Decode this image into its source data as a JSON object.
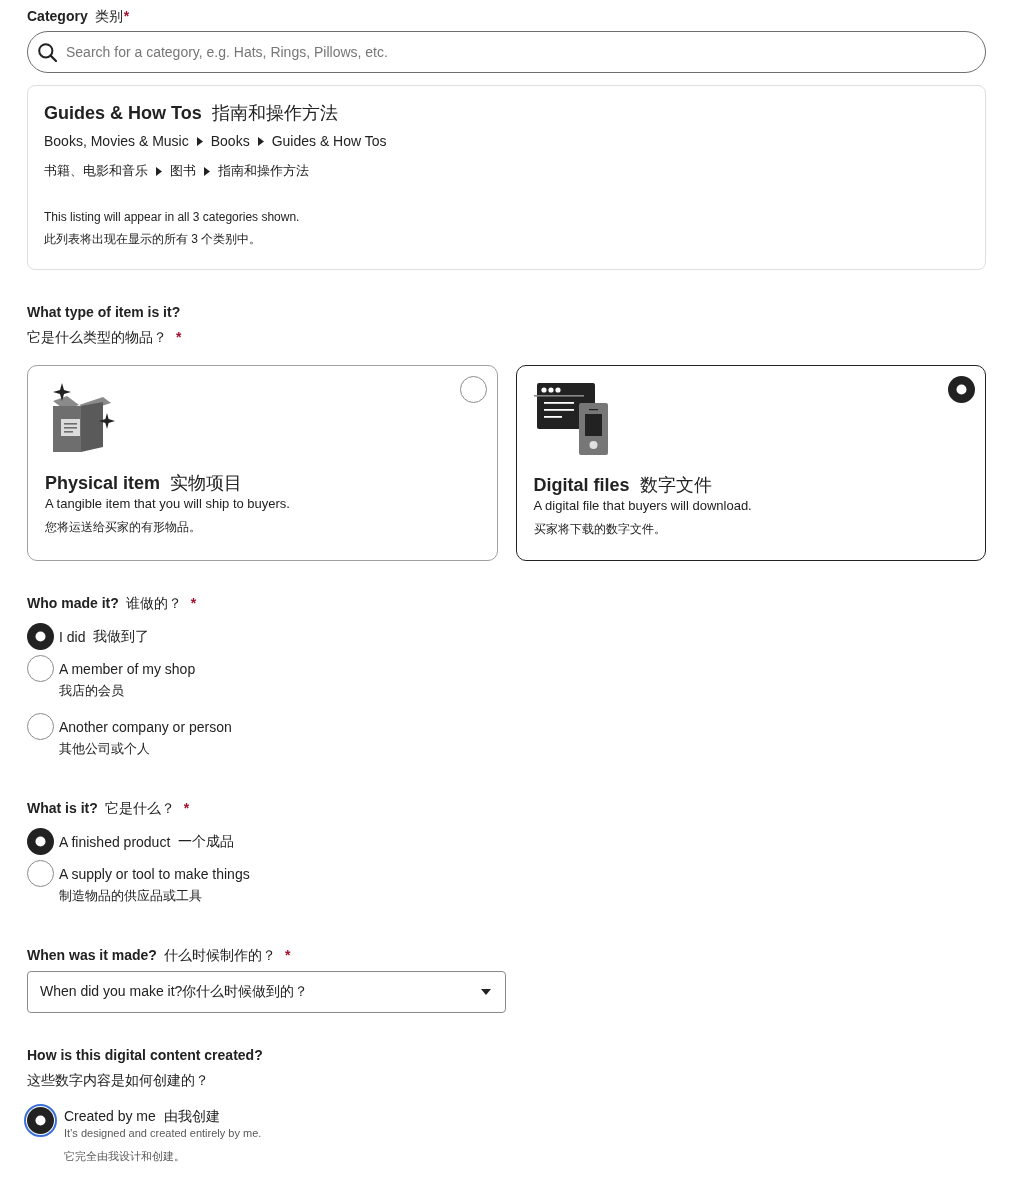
{
  "category": {
    "label": "Category",
    "label_zh": "类别",
    "required_mark": "*",
    "search": {
      "placeholder": "Search for a category, e.g. Hats, Rings, Pillows, etc."
    },
    "selected": {
      "title": "Guides & How Tos",
      "title_zh": "指南和操作方法",
      "path": [
        "Books, Movies & Music",
        "Books",
        "Guides & How Tos"
      ],
      "path_zh": [
        "书籍、电影和音乐",
        "图书",
        "指南和操作方法"
      ],
      "note": "This listing will appear in all 3 categories shown.",
      "note_zh": "此列表将出现在显示的所有 3 个类别中。"
    }
  },
  "item_type": {
    "label": "What type of item is it?",
    "label_below": "它是什么类型的物品？",
    "required_mark": "*",
    "options": [
      {
        "kind": "physical",
        "title": "Physical item",
        "title_zh": "实物项目",
        "description": "A tangible item that you will ship to buyers.",
        "description_zh": "您将运送给买家的有形物品。",
        "selected": false
      },
      {
        "kind": "digital",
        "title": "Digital files",
        "title_zh": "数字文件",
        "description": "A digital file that buyers will download.",
        "description_zh": "买家将下载的数字文件。",
        "selected": true
      }
    ]
  },
  "who_made": {
    "label": "Who made it?",
    "label_zh": "谁做的？",
    "required_mark": "*",
    "options": [
      {
        "label": "I did",
        "label_zh": "我做到了",
        "selected": true
      },
      {
        "label": "A member of my shop",
        "sub_zh": "我店的会员",
        "selected": false
      },
      {
        "label": "Another company or person",
        "sub_zh": "其他公司或个人",
        "selected": false
      }
    ]
  },
  "what_is_it": {
    "label": "What is it?",
    "label_zh": "它是什么？",
    "required_mark": "*",
    "options": [
      {
        "label": "A finished product",
        "label_zh": "一个成品",
        "selected": true
      },
      {
        "label": "A supply or tool to make things",
        "sub_zh": "制造物品的供应品或工具",
        "selected": false
      }
    ]
  },
  "when_made": {
    "label": "When was it made?",
    "label_zh": "什么时候制作的？",
    "required_mark": "*",
    "select": {
      "value": "When did you make it?你什么时候做到的？"
    }
  },
  "creation": {
    "label": "How is this digital content created?",
    "label_below": "这些数字内容是如何创建的？",
    "options": [
      {
        "label": "Created by me",
        "label_zh": "由我创建",
        "description": "It’s designed and created entirely by me.",
        "sub_zh": "它完全由我设计和创建。",
        "selected": true,
        "focused": true
      }
    ]
  }
}
